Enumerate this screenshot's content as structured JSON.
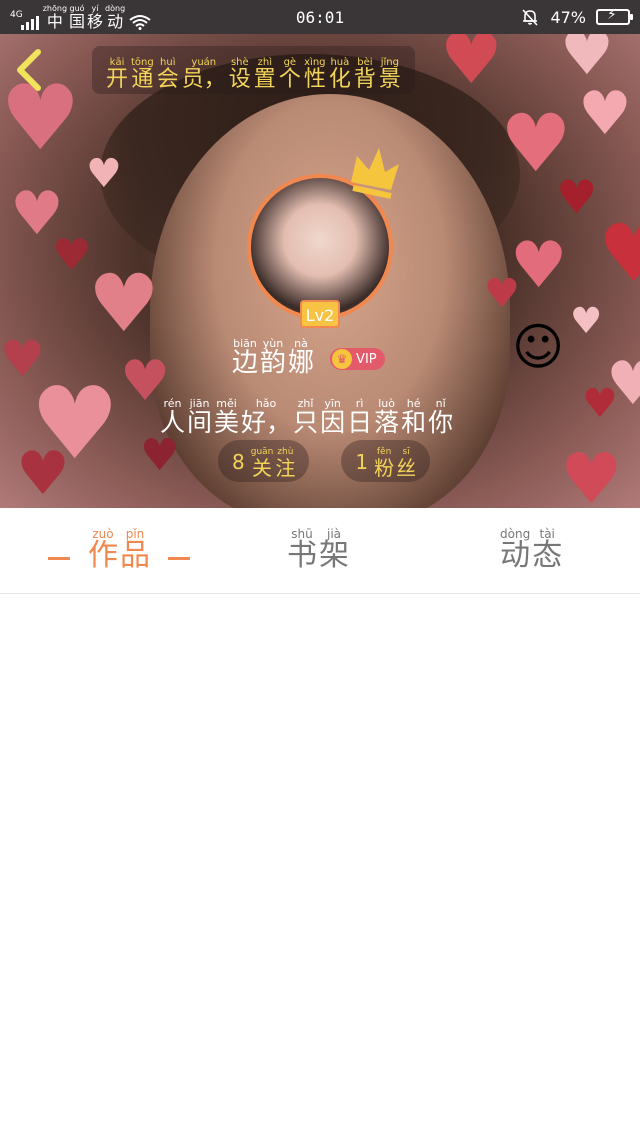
{
  "status_bar": {
    "network": "4G",
    "carrier": [
      {
        "hz": "中",
        "py": "zhōng"
      },
      {
        "hz": "国",
        "py": "guó"
      },
      {
        "hz": "移",
        "py": "yí"
      },
      {
        "hz": "动",
        "py": "dòng"
      }
    ],
    "time": "06:01",
    "battery": "47%",
    "battery_level": 0.47
  },
  "header": {
    "vip_banner": [
      {
        "hz": "开",
        "py": "kāi"
      },
      {
        "hz": "通",
        "py": "tōng"
      },
      {
        "hz": "会",
        "py": "huì"
      },
      {
        "hz": "员，",
        "py": "yuán"
      },
      {
        "hz": "设",
        "py": "shè"
      },
      {
        "hz": "置",
        "py": "zhì"
      },
      {
        "hz": "个",
        "py": "gè"
      },
      {
        "hz": "性",
        "py": "xìng"
      },
      {
        "hz": "化",
        "py": "huà"
      },
      {
        "hz": "背",
        "py": "bèi"
      },
      {
        "hz": "景",
        "py": "jǐng"
      }
    ],
    "level": "Lv2",
    "username": [
      {
        "hz": "边",
        "py": "biān"
      },
      {
        "hz": "韵",
        "py": "yùn"
      },
      {
        "hz": "娜",
        "py": "nà"
      }
    ],
    "vip_label": "VIP",
    "motto": [
      {
        "hz": "人",
        "py": "rén"
      },
      {
        "hz": "间",
        "py": "jiān"
      },
      {
        "hz": "美",
        "py": "měi"
      },
      {
        "hz": "好，",
        "py": "hǎo"
      },
      {
        "hz": "只",
        "py": "zhǐ"
      },
      {
        "hz": "因",
        "py": "yīn"
      },
      {
        "hz": "日",
        "py": "rì"
      },
      {
        "hz": "落",
        "py": "luò"
      },
      {
        "hz": "和",
        "py": "hé"
      },
      {
        "hz": "你",
        "py": "nǐ"
      }
    ],
    "following": {
      "count": "8",
      "label": [
        {
          "hz": "关",
          "py": "guān"
        },
        {
          "hz": "注",
          "py": "zhù"
        }
      ]
    },
    "followers": {
      "count": "1",
      "label": [
        {
          "hz": "粉",
          "py": "fěn"
        },
        {
          "hz": "丝",
          "py": "sī"
        }
      ]
    }
  },
  "tabs": [
    {
      "id": "works",
      "label": [
        {
          "hz": "作",
          "py": "zuò"
        },
        {
          "hz": "品",
          "py": "pǐn"
        }
      ],
      "active": true
    },
    {
      "id": "shelf",
      "label": [
        {
          "hz": "书",
          "py": "shū"
        },
        {
          "hz": "架",
          "py": "jià"
        }
      ],
      "active": false
    },
    {
      "id": "feed",
      "label": [
        {
          "hz": "动",
          "py": "dòng"
        },
        {
          "hz": "态",
          "py": "tài"
        }
      ],
      "active": false
    }
  ],
  "colors": {
    "accent": "#f0884f",
    "banner_text": "#f2d45a",
    "status_bar": "#3a3536",
    "vip_badge": "#e35a6b"
  }
}
